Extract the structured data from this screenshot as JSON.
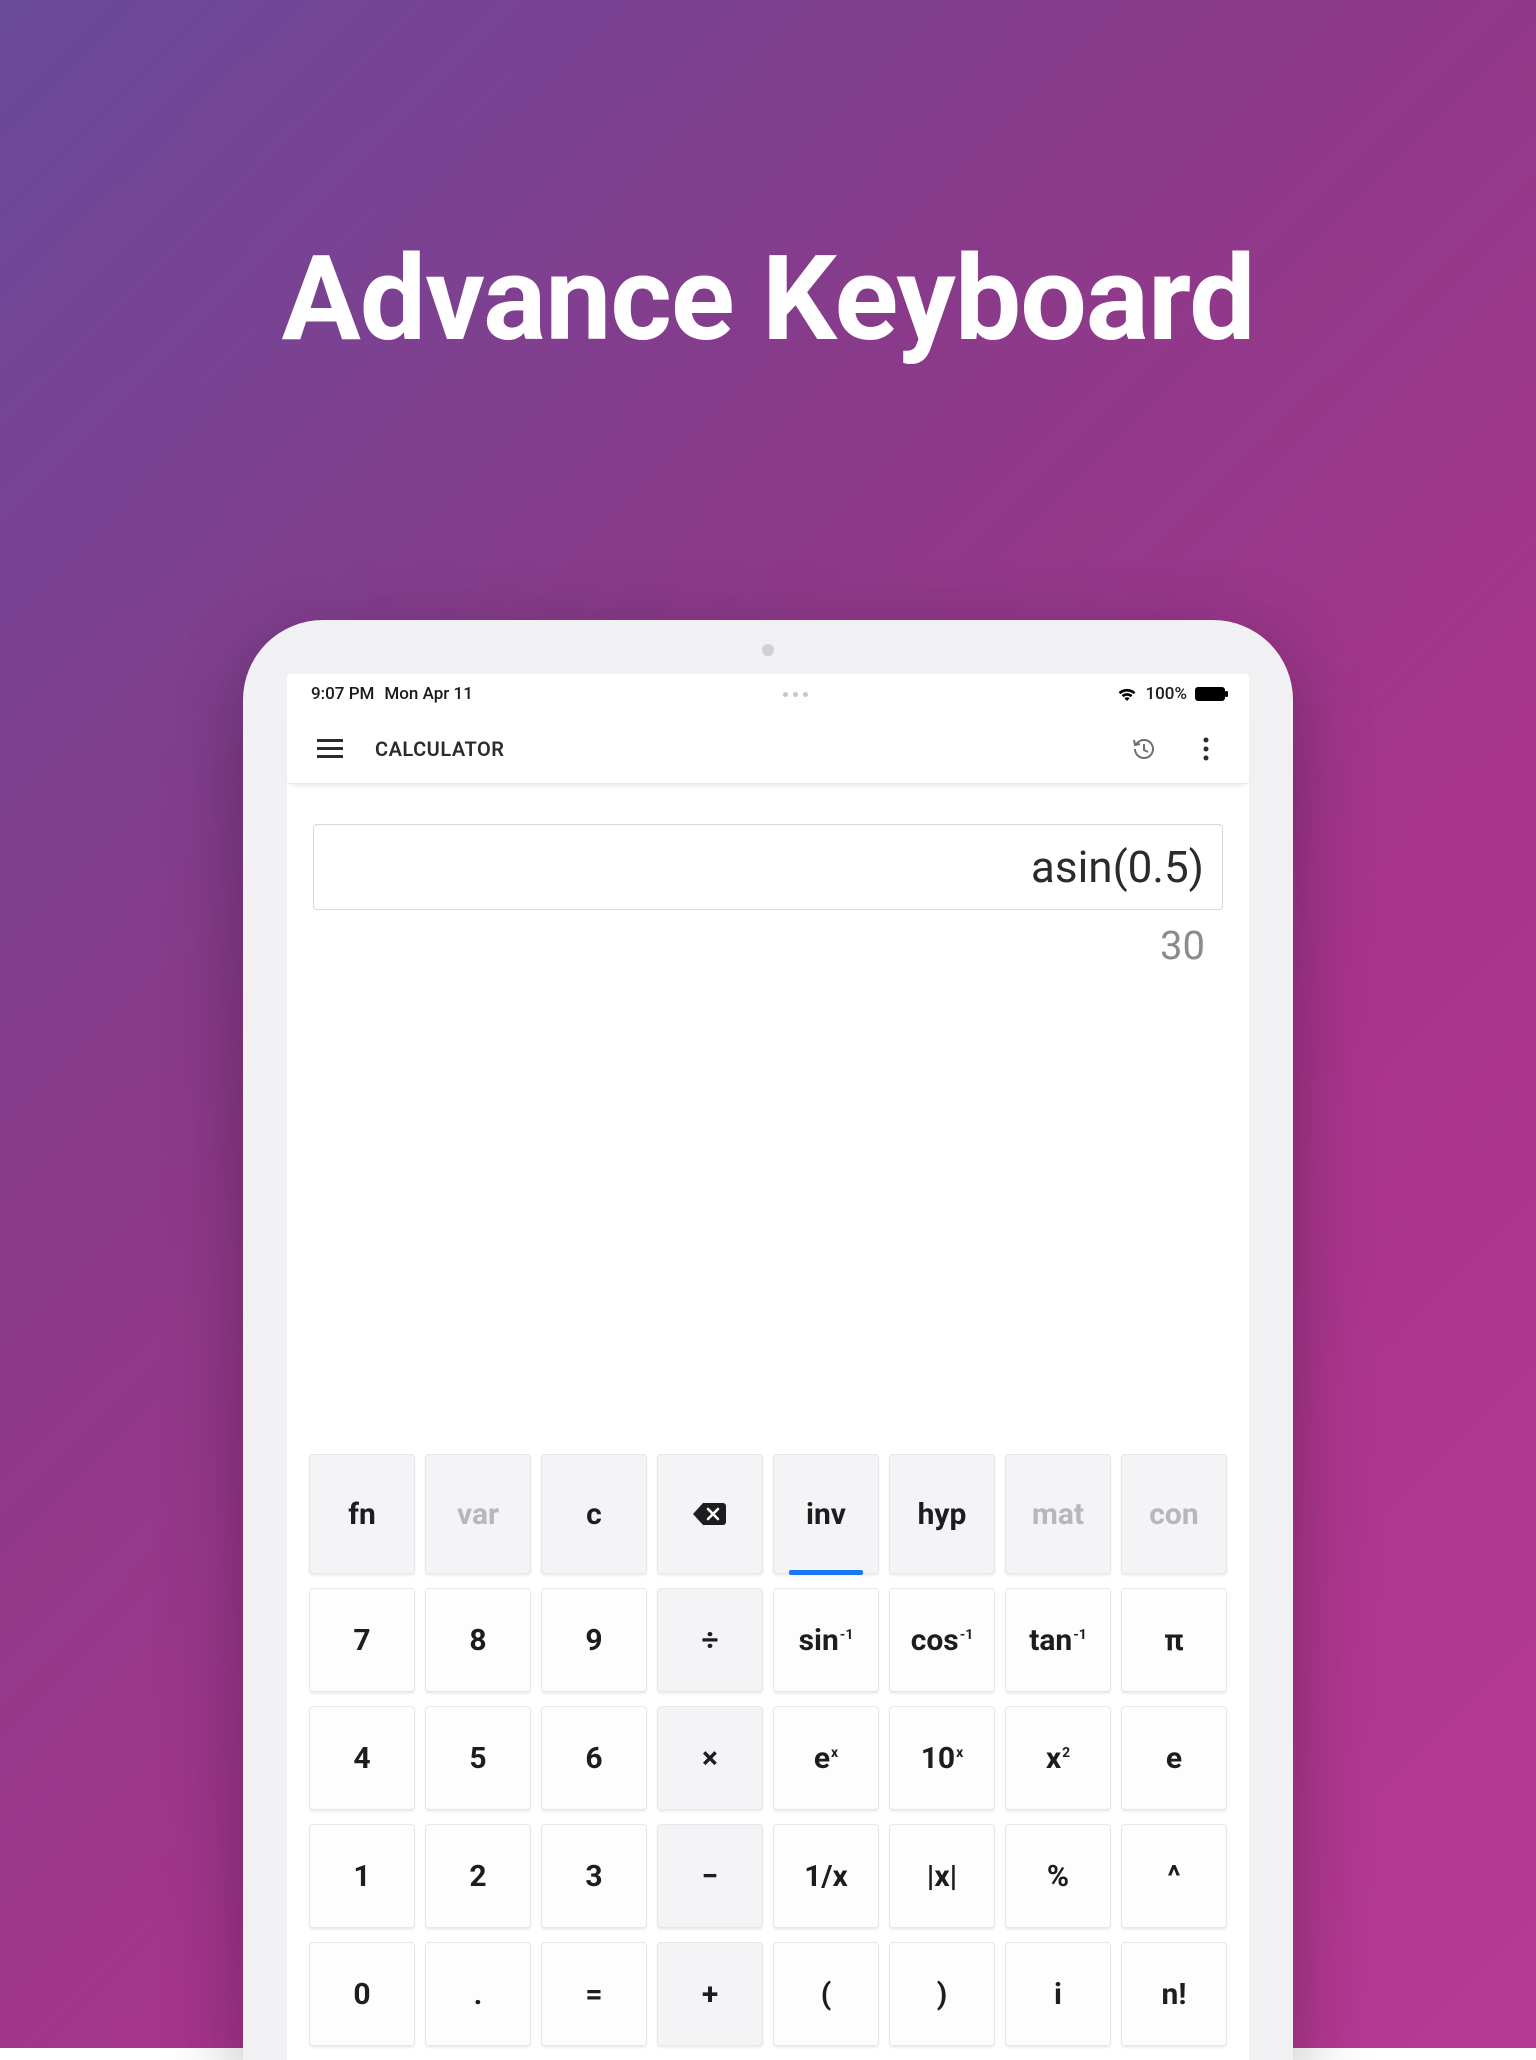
{
  "headline": "Advance Keyboard",
  "statusbar": {
    "time": "9:07 PM",
    "date": "Mon Apr 11",
    "battery_pct": "100%"
  },
  "appbar": {
    "title": "CALCULATOR"
  },
  "display": {
    "expression": "asin(0.5)",
    "result": "30"
  },
  "rows": {
    "r0": {
      "k0": "fn",
      "k1": "var",
      "k2": "c",
      "k4": "inv",
      "k5": "hyp",
      "k6": "mat",
      "k7": "con"
    },
    "r1": {
      "k0": "7",
      "k1": "8",
      "k2": "9",
      "k3": "÷",
      "k4_base": "sin",
      "k4_sup": "-1",
      "k5_base": "cos",
      "k5_sup": "-1",
      "k6_base": "tan",
      "k6_sup": "-1",
      "k7": "π"
    },
    "r2": {
      "k0": "4",
      "k1": "5",
      "k2": "6",
      "k3": "×",
      "k4_base": "e",
      "k4_sup": "x",
      "k5_base": "10",
      "k5_sup": "x",
      "k6_base": "x",
      "k6_sup": "2",
      "k7": "e"
    },
    "r3": {
      "k0": "1",
      "k1": "2",
      "k2": "3",
      "k3": "−",
      "k4": "1/x",
      "k5": "|x|",
      "k6": "%",
      "k7": "^"
    },
    "r4": {
      "k0": "0",
      "k1": ".",
      "k2": "=",
      "k3": "+",
      "k4": "(",
      "k5": ")",
      "k6": "i",
      "k7": "n!"
    }
  }
}
